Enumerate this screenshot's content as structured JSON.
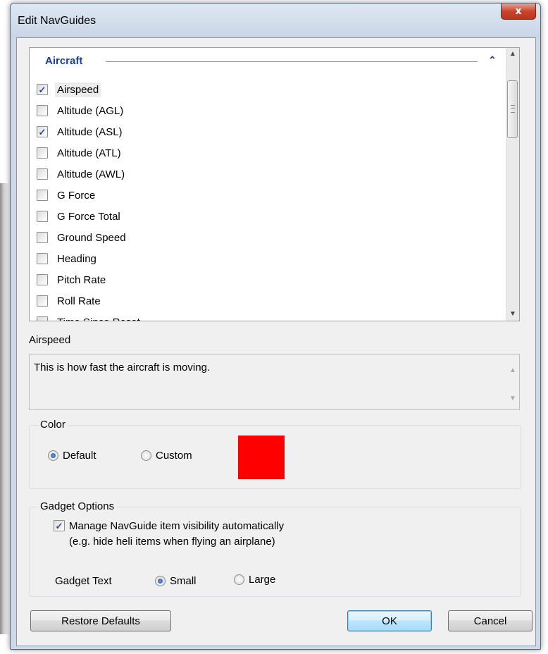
{
  "window": {
    "title": "Edit NavGuides",
    "close_glyph": "x"
  },
  "navguides": {
    "group": {
      "title": "Aircraft",
      "collapse_icon": "chevron-up-icon"
    },
    "items": [
      {
        "label": "Airspeed",
        "checked": true,
        "selected": true
      },
      {
        "label": "Altitude (AGL)",
        "checked": false
      },
      {
        "label": "Altitude (ASL)",
        "checked": true
      },
      {
        "label": "Altitude (ATL)",
        "checked": false
      },
      {
        "label": "Altitude (AWL)",
        "checked": false
      },
      {
        "label": "G Force",
        "checked": false
      },
      {
        "label": "G Force Total",
        "checked": false
      },
      {
        "label": "Ground Speed",
        "checked": false
      },
      {
        "label": "Heading",
        "checked": false
      },
      {
        "label": "Pitch Rate",
        "checked": false
      },
      {
        "label": "Roll Rate",
        "checked": false
      },
      {
        "label": "Time Since Reset",
        "checked": false
      }
    ]
  },
  "description": {
    "title": "Airspeed",
    "text": "This is how fast the aircraft is moving."
  },
  "color": {
    "legend": "Color",
    "default_label": "Default",
    "custom_label": "Custom",
    "selected": "default",
    "swatch_color": "#ff0000"
  },
  "gadget": {
    "legend": "Gadget Options",
    "manage_label_line1": "Manage NavGuide item visibility automatically",
    "manage_label_line2": "(e.g. hide heli items when flying an airplane)",
    "manage_checked": true,
    "text_label": "Gadget Text",
    "small_label": "Small",
    "large_label": "Large",
    "text_size": "small"
  },
  "buttons": {
    "restore": "Restore Defaults",
    "ok": "OK",
    "cancel": "Cancel"
  }
}
